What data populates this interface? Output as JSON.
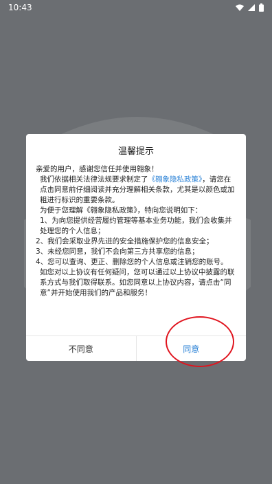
{
  "status_bar": {
    "time": "10:43",
    "icons": [
      "wifi-icon",
      "signal-icon",
      "battery-icon"
    ]
  },
  "dialog": {
    "title": "温馨提示",
    "greeting": "亲爱的用户，感谢您信任并使用翱象！",
    "para1_prefix": "我们依据相关法律法规要求制定了",
    "policy_link": "《翱象隐私政策》",
    "para1_suffix": "，请您在点击同意前仔细阅读并充分理解相关条款，尤其是以颜色或加粗进行标识的重要条款。",
    "para2": "为便于您理解《翱象隐私政策》，特向您说明如下：",
    "items": [
      "1、为向您提供经营履约管理等基本业务功能，我们会收集并处理您的个人信息；",
      "2、我们会采取业界先进的安全措施保护您的信息安全；",
      "3、未经您同意，我们不会向第三方共享您的信息；",
      "4、您可以查询、更正、删除您的个人信息或注销您的账号。"
    ],
    "closing": "如您对以上协议有任何疑问，您可以通过以上协议中披露的联系方式与我们取得联系。如您同意以上协议内容，请点击“同意”并开始使用我们的产品和服务！",
    "disagree_label": "不同意",
    "agree_label": "同意"
  },
  "colors": {
    "accent": "#2b82d6",
    "backdrop": "#6b6e72",
    "annotation": "#e0141e"
  }
}
